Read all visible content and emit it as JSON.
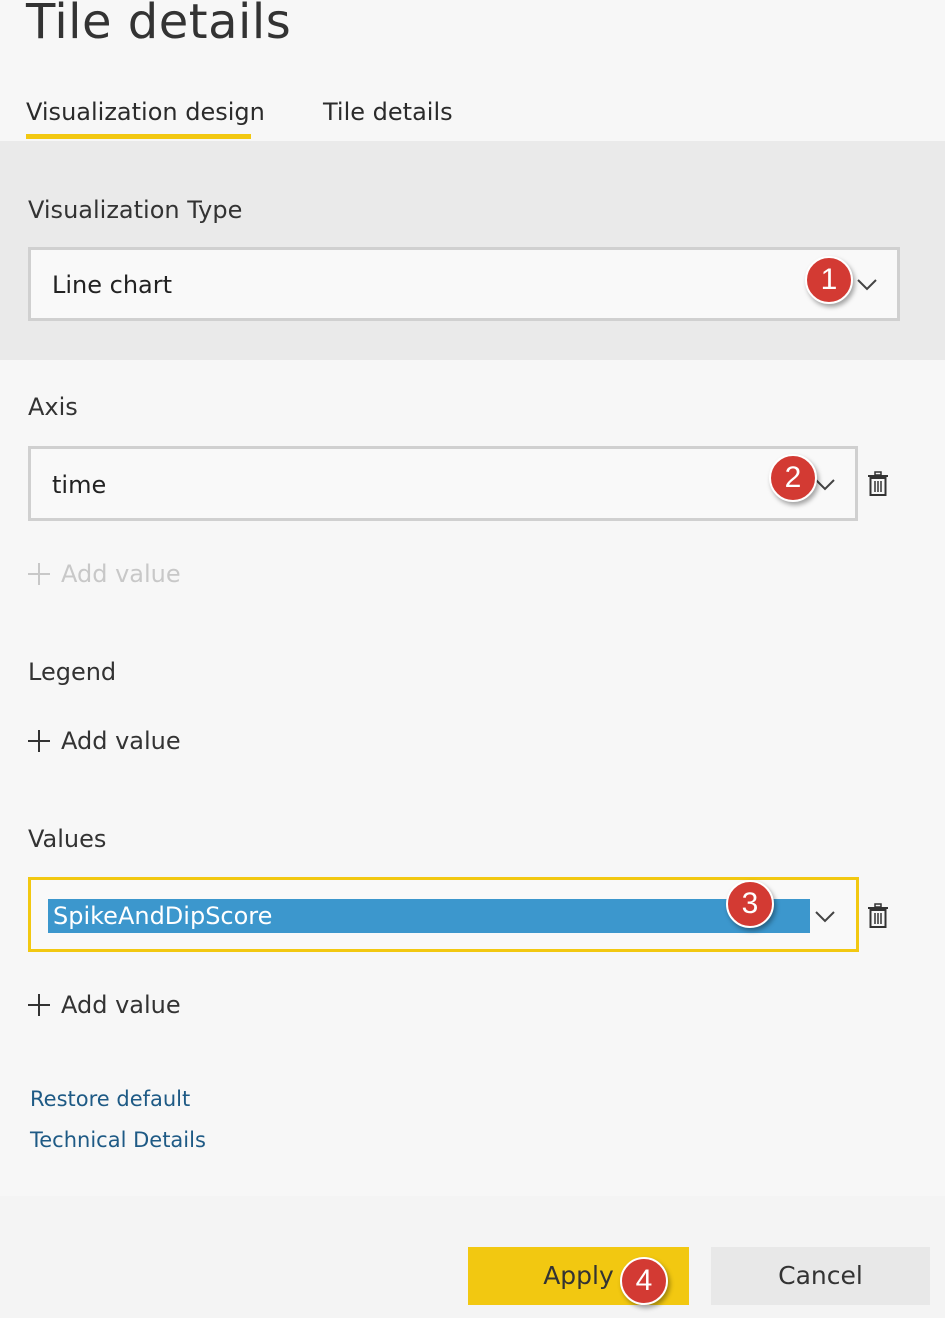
{
  "header": {
    "title": "Tile details"
  },
  "tabs": [
    {
      "label": "Visualization design",
      "active": true
    },
    {
      "label": "Tile details",
      "active": false
    }
  ],
  "visualization_type": {
    "label": "Visualization Type",
    "value": "Line chart",
    "callout": "1"
  },
  "axis": {
    "label": "Axis",
    "value": "time",
    "callout": "2",
    "add_value_label": "Add value",
    "add_value_enabled": false
  },
  "legend": {
    "label": "Legend",
    "add_value_label": "Add value"
  },
  "values": {
    "label": "Values",
    "value": "SpikeAndDipScore",
    "callout": "3",
    "add_value_label": "Add value"
  },
  "links": {
    "restore_default": "Restore default",
    "technical_details": "Technical Details"
  },
  "footer": {
    "apply_label": "Apply",
    "apply_callout": "4",
    "cancel_label": "Cancel"
  },
  "colors": {
    "accent_yellow": "#f2c811",
    "callout_red": "#d33a33",
    "selection_blue": "#3c97cd",
    "link_blue": "#1e5a85"
  }
}
